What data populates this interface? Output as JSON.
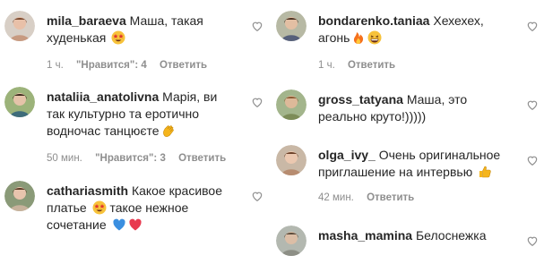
{
  "comments_left": [
    {
      "username": "mila_baraeva",
      "text": "Маша, такая худенькая",
      "emojis": [
        "star-eyes-emoji"
      ],
      "time": "1 ч.",
      "likes": "\"Нравится\": 4",
      "reply": "Ответить"
    },
    {
      "username": "nataliia_anatolivna",
      "text": "Марія, ви так культурно та еротично водночас танцюєте",
      "emojis": [
        "clapping-hands-emoji"
      ],
      "time": "50 мин.",
      "likes": "\"Нравится\": 3",
      "reply": "Ответить"
    },
    {
      "username": "cathariasmith",
      "text": "Какое красивое платье",
      "text2": "такое нежное сочетание",
      "emojis": [
        "star-eyes-emoji",
        "blue-heart-emoji",
        "red-heart-emoji"
      ]
    }
  ],
  "comments_right": [
    {
      "username": "bondarenko.taniaa",
      "text": "Хехехех, агонь",
      "emojis": [
        "fire-emoji",
        "laughing-emoji"
      ],
      "time": "1 ч.",
      "reply": "Ответить"
    },
    {
      "username": "gross_tatyana",
      "text": "Маша, это реально круто!)))))"
    },
    {
      "username": "olga_ivy_",
      "text": "Очень оригинальное приглашение на интервью",
      "emojis": [
        "thumbs-up-emoji"
      ],
      "time": "42 мин.",
      "reply": "Ответить"
    },
    {
      "username": "masha_mamina",
      "text": "Белоснежка"
    }
  ],
  "colors": {
    "text": "#262626",
    "meta": "#8e8e8e",
    "heart_outline": "#8e8e8e"
  }
}
